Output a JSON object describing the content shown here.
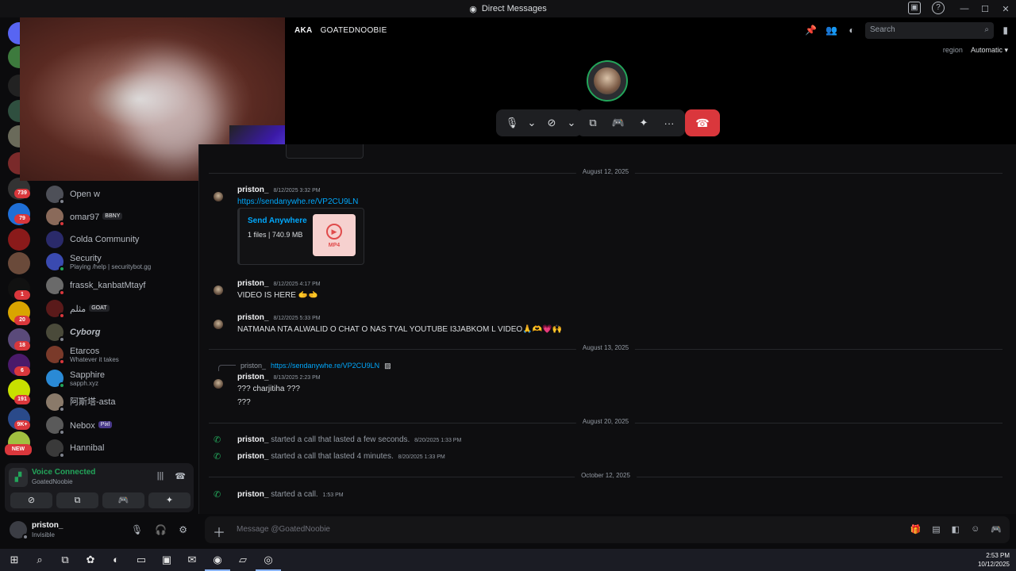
{
  "window": {
    "title": "Direct Messages",
    "min": "—",
    "max": "☐",
    "close": "✕",
    "extra_icons": [
      "inbox-icon",
      "help-icon"
    ]
  },
  "rail": {
    "badges": [
      "739",
      "79",
      "1",
      "20",
      "18",
      "6",
      "191",
      "9K+",
      "NEW"
    ]
  },
  "header": {
    "prefix": "AKA",
    "dm_name": "GOATEDNOOBIE",
    "search_placeholder": "Search",
    "region_label": "region",
    "region_value": "Automatic ▾"
  },
  "dms": [
    {
      "name": "Open w",
      "sub": "",
      "tag": ""
    },
    {
      "name": "omar97",
      "sub": "",
      "tag": "BBNY"
    },
    {
      "name": "Colda Community",
      "sub": "",
      "tag": ""
    },
    {
      "name": "Security",
      "sub": "Playing /help | securitybot.gg",
      "tag": ""
    },
    {
      "name": "frassk_kanbatMtayf",
      "sub": "",
      "tag": ""
    },
    {
      "name": "مثلم",
      "sub": "",
      "tag": "GOAT"
    },
    {
      "name": "Cyborg",
      "sub": "",
      "tag": ""
    },
    {
      "name": "Etarcos",
      "sub": "Whatever it takes",
      "tag": ""
    },
    {
      "name": "Sapphire",
      "sub": "sapph.xyz",
      "tag": ""
    },
    {
      "name": "阿斯塔-asta",
      "sub": "",
      "tag": ""
    },
    {
      "name": "Nebox",
      "sub": "",
      "tag": "Pixl"
    },
    {
      "name": "Hannibal",
      "sub": "",
      "tag": ""
    }
  ],
  "voice": {
    "title": "Voice Connected",
    "sub": "GoatedNoobie"
  },
  "user": {
    "name": "priston_",
    "status": "Invisible"
  },
  "chat": {
    "dividers": [
      "August 12, 2025",
      "August 13, 2025",
      "August 20, 2025",
      "October 12, 2025"
    ],
    "messages": [
      {
        "author": "priston_",
        "time": "8/12/2025 3:32 PM",
        "body": "https://sendanywhe.re/VP2CU9LN"
      },
      {
        "author": "priston_",
        "time": "8/12/2025 4:17 PM",
        "body": "VIDEO IS HERE 🫱🫲"
      },
      {
        "author": "priston_",
        "time": "8/12/2025 5:33 PM",
        "body": "NATMANA NTA ALWALID O CHAT O NAS TYAL YOUTUBE I3JABKOM L VIDEO🙏🫶💗🙌"
      },
      {
        "author": "priston_",
        "time": "8/13/2025 2:23 PM",
        "body": "??? charjitiha ???",
        "body2": "???"
      }
    ],
    "embed": {
      "name": "Send Anywhere",
      "desc": "1 files | 740.9 MB",
      "format": "MP4"
    },
    "reply": {
      "author": "priston_",
      "text": "https://sendanywhe.re/VP2CU9LN"
    },
    "calls": [
      {
        "author": "priston_",
        "text": "started a call that lasted a few seconds.",
        "time": "8/20/2025 1:33 PM"
      },
      {
        "author": "priston_",
        "text": "started a call that lasted 4 minutes.",
        "time": "8/20/2025 1:33 PM"
      },
      {
        "author": "priston_",
        "text": "started a call.",
        "time": "1:53 PM"
      }
    ]
  },
  "composer": {
    "placeholder": "Message @GoatedNoobie"
  },
  "taskbar": {
    "time": "2:53 PM",
    "date": "10/12/2025"
  }
}
